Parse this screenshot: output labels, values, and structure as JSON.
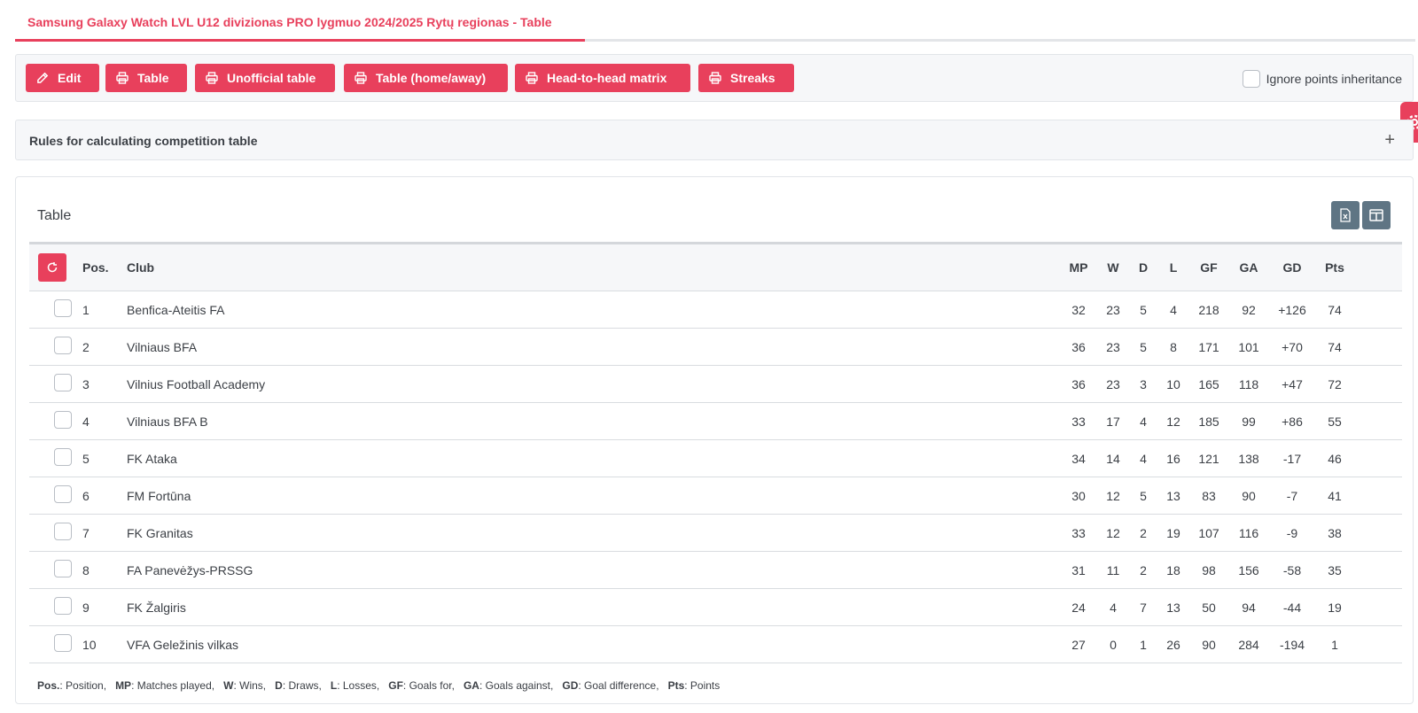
{
  "page_tab": {
    "title": "Samsung Galaxy Watch LVL U12 divizionas PRO lygmuo 2024/2025 Rytų regionas - Table"
  },
  "toolbar": {
    "buttons": [
      {
        "label": "Edit",
        "icon": "pencil-icon"
      },
      {
        "label": "Table",
        "icon": "printer-icon"
      },
      {
        "label": "Unofficial table",
        "icon": "printer-icon"
      },
      {
        "label": "Table (home/away)",
        "icon": "printer-icon"
      },
      {
        "label": "Head-to-head matrix",
        "icon": "printer-icon"
      },
      {
        "label": "Streaks",
        "icon": "printer-icon"
      }
    ],
    "ignore_label": "Ignore points inheritance"
  },
  "rules_panel": {
    "title": "Rules for calculating competition table",
    "toggle": "+"
  },
  "card": {
    "title": "Table",
    "tools": [
      "excel-export-icon",
      "columns-icon"
    ]
  },
  "table": {
    "headers": [
      "Pos.",
      "Club",
      "MP",
      "W",
      "D",
      "L",
      "GF",
      "GA",
      "GD",
      "Pts"
    ],
    "rows": [
      [
        "1",
        "Benfica-Ateitis FA",
        "32",
        "23",
        "5",
        "4",
        "218",
        "92",
        "+126",
        "74"
      ],
      [
        "2",
        "Vilniaus BFA",
        "36",
        "23",
        "5",
        "8",
        "171",
        "101",
        "+70",
        "74"
      ],
      [
        "3",
        "Vilnius Football Academy",
        "36",
        "23",
        "3",
        "10",
        "165",
        "118",
        "+47",
        "72"
      ],
      [
        "4",
        "Vilniaus BFA B",
        "33",
        "17",
        "4",
        "12",
        "185",
        "99",
        "+86",
        "55"
      ],
      [
        "5",
        "FK Ataka",
        "34",
        "14",
        "4",
        "16",
        "121",
        "138",
        "-17",
        "46"
      ],
      [
        "6",
        "FM Fortūna",
        "30",
        "12",
        "5",
        "13",
        "83",
        "90",
        "-7",
        "41"
      ],
      [
        "7",
        "FK Granitas",
        "33",
        "12",
        "2",
        "19",
        "107",
        "116",
        "-9",
        "38"
      ],
      [
        "8",
        "FA Panevėžys-PRSSG",
        "31",
        "11",
        "2",
        "18",
        "98",
        "156",
        "-58",
        "35"
      ],
      [
        "9",
        "FK Žalgiris",
        "24",
        "4",
        "7",
        "13",
        "50",
        "94",
        "-44",
        "19"
      ],
      [
        "10",
        "VFA Geležinis vilkas",
        "27",
        "0",
        "1",
        "26",
        "90",
        "284",
        "-194",
        "1"
      ]
    ]
  },
  "legend": [
    {
      "key": "Pos.",
      "text": ": Position,"
    },
    {
      "key": "MP",
      "text": ": Matches played,"
    },
    {
      "key": "W",
      "text": ": Wins,"
    },
    {
      "key": "D",
      "text": ": Draws,"
    },
    {
      "key": "L",
      "text": ": Losses,"
    },
    {
      "key": "GF",
      "text": ": Goals for,"
    },
    {
      "key": "GA",
      "text": ": Goals against,"
    },
    {
      "key": "GD",
      "text": ": Goal difference,"
    },
    {
      "key": "Pts",
      "text": ": Points"
    }
  ],
  "colors": {
    "accent": "#e8405c",
    "tool_button": "#5f7584",
    "panel_bg": "#f6f7f9"
  }
}
